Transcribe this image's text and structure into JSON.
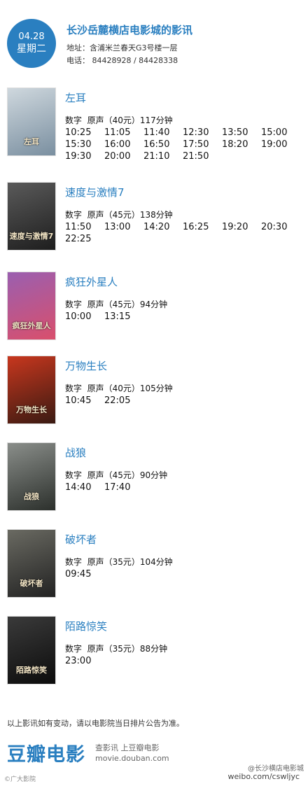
{
  "header": {
    "date": "04.28",
    "weekday": "星期二",
    "title": "长沙岳麓横店电影城的影讯",
    "address": "地址：含浦米兰春天G3号楼一层",
    "phone": "电话： 84428928 / 84428338"
  },
  "movies": [
    {
      "title": "左耳",
      "meta": "数字  原声（40元）117分钟",
      "poster_text": "左耳",
      "poster_colors": [
        "#cfd8de",
        "#7a8fa0"
      ],
      "times": [
        "10:25",
        "11:05",
        "11:40",
        "12:30",
        "13:50",
        "15:00",
        "15:30",
        "16:00",
        "16:50",
        "17:50",
        "18:20",
        "19:00",
        "19:30",
        "20:00",
        "21:10",
        "21:50"
      ]
    },
    {
      "title": "速度与激情7",
      "meta": "数字  原声（45元）138分钟",
      "poster_text": "速度与激情7",
      "poster_colors": [
        "#5a5a5a",
        "#1e1e1e"
      ],
      "times": [
        "11:50",
        "13:00",
        "14:20",
        "16:25",
        "19:20",
        "20:30",
        "22:25"
      ]
    },
    {
      "title": "疯狂外星人",
      "meta": "数字  原声（45元）94分钟",
      "poster_text": "疯狂外星人",
      "poster_colors": [
        "#9a5fb0",
        "#d94f6c"
      ],
      "times": [
        "10:00",
        "13:15"
      ]
    },
    {
      "title": "万物生长",
      "meta": "数字  原声（40元）105分钟",
      "poster_text": "万物生长",
      "poster_colors": [
        "#c8371e",
        "#3a1a12"
      ],
      "times": [
        "10:45",
        "22:05"
      ]
    },
    {
      "title": "战狼",
      "meta": "数字  原声（45元）90分钟",
      "poster_text": "战狼",
      "poster_colors": [
        "#8a8e8a",
        "#2c302c"
      ],
      "times": [
        "14:40",
        "17:40"
      ]
    },
    {
      "title": "破坏者",
      "meta": "数字  原声（35元）104分钟",
      "poster_text": "破坏者",
      "poster_colors": [
        "#6a6a62",
        "#222"
      ],
      "times": [
        "09:45"
      ]
    },
    {
      "title": "陌路惊笑",
      "meta": "数字  原声（35元）88分钟",
      "poster_text": "陌路惊笑",
      "poster_colors": [
        "#3a3a3a",
        "#0c0c0c"
      ],
      "times": [
        "23:00"
      ]
    }
  ],
  "footer": {
    "notice": "以上影讯如有变动，请以电影院当日排片公告为准。",
    "brand": "豆瓣电影",
    "links": "查影讯  上豆瓣电影",
    "url": "movie.douban.com",
    "weibo_tag": "@长沙横店电影城",
    "weibo_url": "weibo.com/cswljyc",
    "corner_mark": "©广大影院"
  },
  "colors": {
    "accent": "#2a7fc0"
  }
}
